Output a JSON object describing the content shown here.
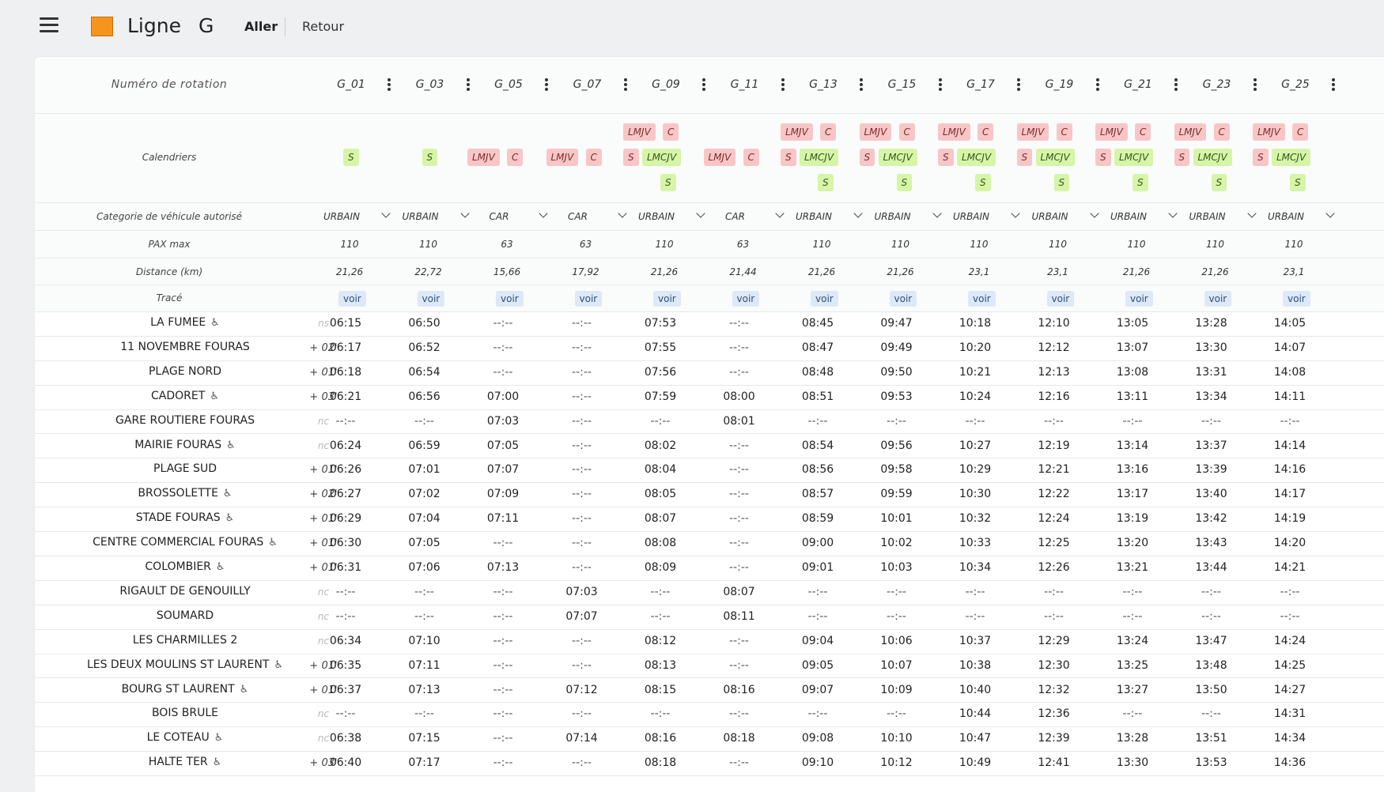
{
  "header": {
    "menu_icon": "hamburger-menu-icon",
    "line_color": "#f7941d",
    "line_label": "Ligne",
    "line_code": "G",
    "tab_aller": "Aller",
    "tab_retour": "Retour"
  },
  "labels": {
    "rotation": "Numéro de rotation",
    "calendriers": "Calendriers",
    "categorie": "Categorie de véhicule autorisé",
    "pax": "PAX max",
    "distance": "Distance (km)",
    "trace": "Tracé"
  },
  "voir_label": "voir",
  "columns": [
    {
      "name": "G_01",
      "badges": [
        [
          "S",
          "green"
        ]
      ],
      "category": "URBAIN",
      "pax": "110",
      "distance": "21,26"
    },
    {
      "name": "G_03",
      "badges": [
        [
          "S",
          "green"
        ]
      ],
      "category": "URBAIN",
      "pax": "110",
      "distance": "22,72"
    },
    {
      "name": "G_05",
      "badges": [
        [
          "LMJV",
          "red"
        ],
        [
          "C",
          "red"
        ]
      ],
      "category": "CAR",
      "pax": "63",
      "distance": "15,66"
    },
    {
      "name": "G_07",
      "badges": [
        [
          "LMJV",
          "red"
        ],
        [
          "C",
          "red"
        ]
      ],
      "category": "CAR",
      "pax": "63",
      "distance": "17,92"
    },
    {
      "name": "G_09",
      "badges": [
        [
          "LMJV",
          "red"
        ],
        [
          "C",
          "red"
        ],
        [
          "S",
          "red"
        ],
        [
          "LMCJV",
          "green"
        ],
        [
          "S",
          "green"
        ]
      ],
      "category": "URBAIN",
      "pax": "110",
      "distance": "21,26"
    },
    {
      "name": "G_11",
      "badges": [
        [
          "LMJV",
          "red"
        ],
        [
          "C",
          "red"
        ]
      ],
      "category": "CAR",
      "pax": "63",
      "distance": "21,44"
    },
    {
      "name": "G_13",
      "badges": [
        [
          "LMJV",
          "red"
        ],
        [
          "C",
          "red"
        ],
        [
          "S",
          "red"
        ],
        [
          "LMCJV",
          "green"
        ],
        [
          "S",
          "green"
        ]
      ],
      "category": "URBAIN",
      "pax": "110",
      "distance": "21,26"
    },
    {
      "name": "G_15",
      "badges": [
        [
          "LMJV",
          "red"
        ],
        [
          "C",
          "red"
        ],
        [
          "S",
          "red"
        ],
        [
          "LMCJV",
          "green"
        ],
        [
          "S",
          "green"
        ]
      ],
      "category": "URBAIN",
      "pax": "110",
      "distance": "21,26"
    },
    {
      "name": "G_17",
      "badges": [
        [
          "LMJV",
          "red"
        ],
        [
          "C",
          "red"
        ],
        [
          "S",
          "red"
        ],
        [
          "LMCJV",
          "green"
        ],
        [
          "S",
          "green"
        ]
      ],
      "category": "URBAIN",
      "pax": "110",
      "distance": "23,1"
    },
    {
      "name": "G_19",
      "badges": [
        [
          "LMJV",
          "red"
        ],
        [
          "C",
          "red"
        ],
        [
          "S",
          "red"
        ],
        [
          "LMCJV",
          "green"
        ],
        [
          "S",
          "green"
        ]
      ],
      "category": "URBAIN",
      "pax": "110",
      "distance": "23,1"
    },
    {
      "name": "G_21",
      "badges": [
        [
          "LMJV",
          "red"
        ],
        [
          "C",
          "red"
        ],
        [
          "S",
          "red"
        ],
        [
          "LMCJV",
          "green"
        ],
        [
          "S",
          "green"
        ]
      ],
      "category": "URBAIN",
      "pax": "110",
      "distance": "21,26"
    },
    {
      "name": "G_23",
      "badges": [
        [
          "LMJV",
          "red"
        ],
        [
          "C",
          "red"
        ],
        [
          "S",
          "red"
        ],
        [
          "LMCJV",
          "green"
        ],
        [
          "S",
          "green"
        ]
      ],
      "category": "URBAIN",
      "pax": "110",
      "distance": "21,26"
    },
    {
      "name": "G_25",
      "badges": [
        [
          "LMJV",
          "red"
        ],
        [
          "C",
          "red"
        ],
        [
          "S",
          "red"
        ],
        [
          "LMCJV",
          "green"
        ],
        [
          "S",
          "green"
        ]
      ],
      "category": "URBAIN",
      "pax": "110",
      "distance": "23,1"
    }
  ],
  "stops": [
    {
      "name": "LA FUMEE",
      "accessible": true,
      "offset": "ns",
      "times": [
        "06:15",
        "06:50",
        "--:--",
        "--:--",
        "07:53",
        "--:--",
        "08:45",
        "09:47",
        "10:18",
        "12:10",
        "13:05",
        "13:28",
        "14:05"
      ]
    },
    {
      "name": "11 NOVEMBRE FOURAS",
      "accessible": false,
      "offset": "+ 02'",
      "times": [
        "06:17",
        "06:52",
        "--:--",
        "--:--",
        "07:55",
        "--:--",
        "08:47",
        "09:49",
        "10:20",
        "12:12",
        "13:07",
        "13:30",
        "14:07"
      ]
    },
    {
      "name": "PLAGE NORD",
      "accessible": false,
      "offset": "+ 01'",
      "times": [
        "06:18",
        "06:54",
        "--:--",
        "--:--",
        "07:56",
        "--:--",
        "08:48",
        "09:50",
        "10:21",
        "12:13",
        "13:08",
        "13:31",
        "14:08"
      ]
    },
    {
      "name": "CADORET",
      "accessible": true,
      "offset": "+ 03'",
      "times": [
        "06:21",
        "06:56",
        "07:00",
        "--:--",
        "07:59",
        "08:00",
        "08:51",
        "09:53",
        "10:24",
        "12:16",
        "13:11",
        "13:34",
        "14:11"
      ]
    },
    {
      "name": "GARE ROUTIERE FOURAS",
      "accessible": false,
      "offset": "nc",
      "times": [
        "--:--",
        "--:--",
        "07:03",
        "--:--",
        "--:--",
        "08:01",
        "--:--",
        "--:--",
        "--:--",
        "--:--",
        "--:--",
        "--:--",
        "--:--"
      ]
    },
    {
      "name": "MAIRIE FOURAS",
      "accessible": true,
      "offset": "nc",
      "times": [
        "06:24",
        "06:59",
        "07:05",
        "--:--",
        "08:02",
        "--:--",
        "08:54",
        "09:56",
        "10:27",
        "12:19",
        "13:14",
        "13:37",
        "14:14"
      ]
    },
    {
      "name": "PLAGE SUD",
      "accessible": false,
      "offset": "+ 01'",
      "times": [
        "06:26",
        "07:01",
        "07:07",
        "--:--",
        "08:04",
        "--:--",
        "08:56",
        "09:58",
        "10:29",
        "12:21",
        "13:16",
        "13:39",
        "14:16"
      ]
    },
    {
      "name": "BROSSOLETTE",
      "accessible": true,
      "offset": "+ 02'",
      "times": [
        "06:27",
        "07:02",
        "07:09",
        "--:--",
        "08:05",
        "--:--",
        "08:57",
        "09:59",
        "10:30",
        "12:22",
        "13:17",
        "13:40",
        "14:17"
      ]
    },
    {
      "name": "STADE FOURAS",
      "accessible": true,
      "offset": "+ 01'",
      "times": [
        "06:29",
        "07:04",
        "07:11",
        "--:--",
        "08:07",
        "--:--",
        "08:59",
        "10:01",
        "10:32",
        "12:24",
        "13:19",
        "13:42",
        "14:19"
      ]
    },
    {
      "name": "CENTRE COMMERCIAL FOURAS",
      "accessible": true,
      "offset": "+ 01'",
      "times": [
        "06:30",
        "07:05",
        "--:--",
        "--:--",
        "08:08",
        "--:--",
        "09:00",
        "10:02",
        "10:33",
        "12:25",
        "13:20",
        "13:43",
        "14:20"
      ]
    },
    {
      "name": "COLOMBIER",
      "accessible": true,
      "offset": "+ 01'",
      "times": [
        "06:31",
        "07:06",
        "07:13",
        "--:--",
        "08:09",
        "--:--",
        "09:01",
        "10:03",
        "10:34",
        "12:26",
        "13:21",
        "13:44",
        "14:21"
      ]
    },
    {
      "name": "RIGAULT DE GENOUILLY",
      "accessible": false,
      "offset": "nc",
      "times": [
        "--:--",
        "--:--",
        "--:--",
        "07:03",
        "--:--",
        "08:07",
        "--:--",
        "--:--",
        "--:--",
        "--:--",
        "--:--",
        "--:--",
        "--:--"
      ]
    },
    {
      "name": "SOUMARD",
      "accessible": false,
      "offset": "nc",
      "times": [
        "--:--",
        "--:--",
        "--:--",
        "07:07",
        "--:--",
        "08:11",
        "--:--",
        "--:--",
        "--:--",
        "--:--",
        "--:--",
        "--:--",
        "--:--"
      ]
    },
    {
      "name": "LES CHARMILLES 2",
      "accessible": false,
      "offset": "nc",
      "times": [
        "06:34",
        "07:10",
        "--:--",
        "--:--",
        "08:12",
        "--:--",
        "09:04",
        "10:06",
        "10:37",
        "12:29",
        "13:24",
        "13:47",
        "14:24"
      ]
    },
    {
      "name": "LES DEUX MOULINS ST LAURENT",
      "accessible": true,
      "offset": "+ 01'",
      "times": [
        "06:35",
        "07:11",
        "--:--",
        "--:--",
        "08:13",
        "--:--",
        "09:05",
        "10:07",
        "10:38",
        "12:30",
        "13:25",
        "13:48",
        "14:25"
      ]
    },
    {
      "name": "BOURG ST LAURENT",
      "accessible": true,
      "offset": "+ 01'",
      "times": [
        "06:37",
        "07:13",
        "--:--",
        "07:12",
        "08:15",
        "08:16",
        "09:07",
        "10:09",
        "10:40",
        "12:32",
        "13:27",
        "13:50",
        "14:27"
      ]
    },
    {
      "name": "BOIS BRULE",
      "accessible": false,
      "offset": "nc",
      "times": [
        "--:--",
        "--:--",
        "--:--",
        "--:--",
        "--:--",
        "--:--",
        "--:--",
        "--:--",
        "10:44",
        "12:36",
        "--:--",
        "--:--",
        "14:31"
      ]
    },
    {
      "name": "LE COTEAU",
      "accessible": true,
      "offset": "nc",
      "times": [
        "06:38",
        "07:15",
        "--:--",
        "07:14",
        "08:16",
        "08:18",
        "09:08",
        "10:10",
        "10:47",
        "12:39",
        "13:28",
        "13:51",
        "14:34"
      ]
    },
    {
      "name": "HALTE TER",
      "accessible": true,
      "offset": "+ 03'",
      "times": [
        "06:40",
        "07:17",
        "--:--",
        "--:--",
        "08:18",
        "--:--",
        "09:10",
        "10:12",
        "10:49",
        "12:41",
        "13:30",
        "13:53",
        "14:36"
      ]
    }
  ]
}
